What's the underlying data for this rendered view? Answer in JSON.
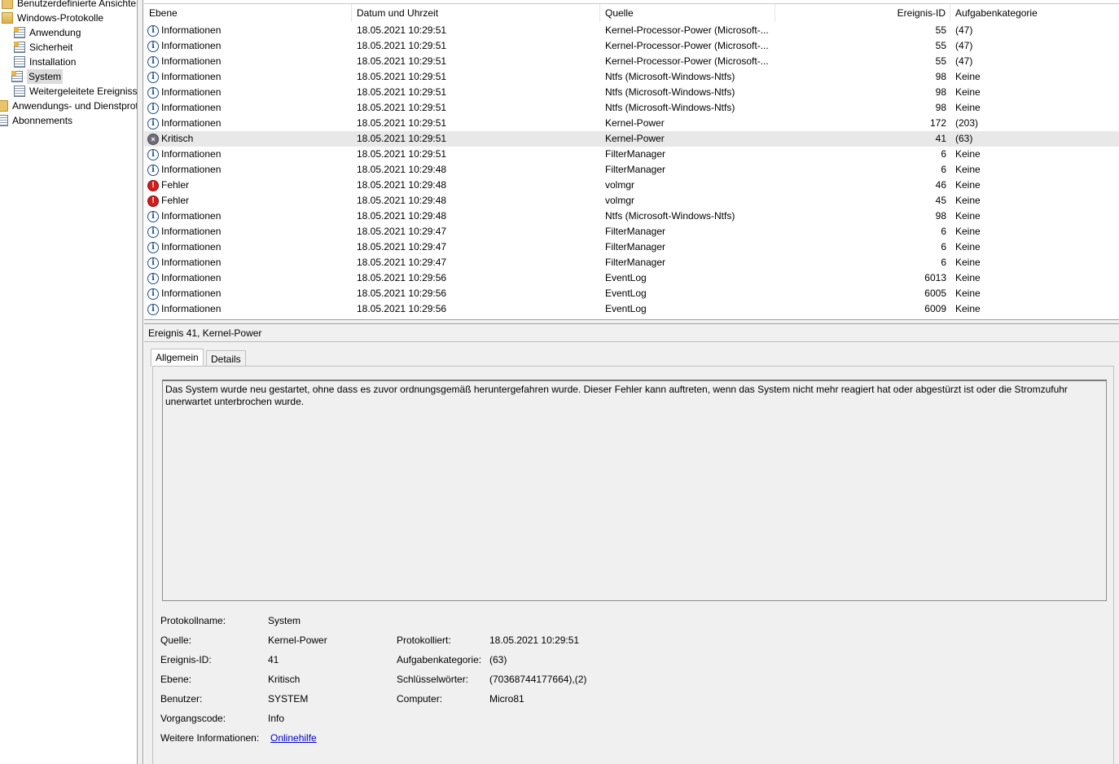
{
  "tree": {
    "items": [
      {
        "label": "Benutzerdefinierte Ansichten",
        "icon": "folder-icon"
      },
      {
        "label": "Windows-Protokolle",
        "icon": "folder-open-icon"
      },
      {
        "label": "Anwendung",
        "icon": "log-warning-icon"
      },
      {
        "label": "Sicherheit",
        "icon": "log-warning-icon"
      },
      {
        "label": "Installation",
        "icon": "log-icon"
      },
      {
        "label": "System",
        "icon": "log-warning-icon"
      },
      {
        "label": "Weitergeleitete Ereignisse",
        "icon": "log-icon"
      },
      {
        "label": "Anwendungs- und Dienstprotokolle",
        "icon": "folder-icon"
      },
      {
        "label": "Abonnements",
        "icon": "log-icon"
      }
    ]
  },
  "list": {
    "columns": [
      "Ebene",
      "Datum und Uhrzeit",
      "Quelle",
      "Ereignis-ID",
      "Aufgabenkategorie"
    ],
    "rows": [
      {
        "level": "Informationen",
        "type": "info",
        "date": "18.05.2021 10:29:51",
        "source": "Kernel-Processor-Power (Microsoft-...",
        "id": "55",
        "category": "(47)"
      },
      {
        "level": "Informationen",
        "type": "info",
        "date": "18.05.2021 10:29:51",
        "source": "Kernel-Processor-Power (Microsoft-...",
        "id": "55",
        "category": "(47)"
      },
      {
        "level": "Informationen",
        "type": "info",
        "date": "18.05.2021 10:29:51",
        "source": "Kernel-Processor-Power (Microsoft-...",
        "id": "55",
        "category": "(47)"
      },
      {
        "level": "Informationen",
        "type": "info",
        "date": "18.05.2021 10:29:51",
        "source": "Ntfs (Microsoft-Windows-Ntfs)",
        "id": "98",
        "category": "Keine"
      },
      {
        "level": "Informationen",
        "type": "info",
        "date": "18.05.2021 10:29:51",
        "source": "Ntfs (Microsoft-Windows-Ntfs)",
        "id": "98",
        "category": "Keine"
      },
      {
        "level": "Informationen",
        "type": "info",
        "date": "18.05.2021 10:29:51",
        "source": "Ntfs (Microsoft-Windows-Ntfs)",
        "id": "98",
        "category": "Keine"
      },
      {
        "level": "Informationen",
        "type": "info",
        "date": "18.05.2021 10:29:51",
        "source": "Kernel-Power",
        "id": "172",
        "category": "(203)"
      },
      {
        "level": "Kritisch",
        "type": "critical",
        "date": "18.05.2021 10:29:51",
        "source": "Kernel-Power",
        "id": "41",
        "category": "(63)"
      },
      {
        "level": "Informationen",
        "type": "info",
        "date": "18.05.2021 10:29:51",
        "source": "FilterManager",
        "id": "6",
        "category": "Keine"
      },
      {
        "level": "Informationen",
        "type": "info",
        "date": "18.05.2021 10:29:48",
        "source": "FilterManager",
        "id": "6",
        "category": "Keine"
      },
      {
        "level": "Fehler",
        "type": "error",
        "date": "18.05.2021 10:29:48",
        "source": "volmgr",
        "id": "46",
        "category": "Keine"
      },
      {
        "level": "Fehler",
        "type": "error",
        "date": "18.05.2021 10:29:48",
        "source": "volmgr",
        "id": "45",
        "category": "Keine"
      },
      {
        "level": "Informationen",
        "type": "info",
        "date": "18.05.2021 10:29:48",
        "source": "Ntfs (Microsoft-Windows-Ntfs)",
        "id": "98",
        "category": "Keine"
      },
      {
        "level": "Informationen",
        "type": "info",
        "date": "18.05.2021 10:29:47",
        "source": "FilterManager",
        "id": "6",
        "category": "Keine"
      },
      {
        "level": "Informationen",
        "type": "info",
        "date": "18.05.2021 10:29:47",
        "source": "FilterManager",
        "id": "6",
        "category": "Keine"
      },
      {
        "level": "Informationen",
        "type": "info",
        "date": "18.05.2021 10:29:47",
        "source": "FilterManager",
        "id": "6",
        "category": "Keine"
      },
      {
        "level": "Informationen",
        "type": "info",
        "date": "18.05.2021 10:29:56",
        "source": "EventLog",
        "id": "6013",
        "category": "Keine"
      },
      {
        "level": "Informationen",
        "type": "info",
        "date": "18.05.2021 10:29:56",
        "source": "EventLog",
        "id": "6005",
        "category": "Keine"
      },
      {
        "level": "Informationen",
        "type": "info",
        "date": "18.05.2021 10:29:56",
        "source": "EventLog",
        "id": "6009",
        "category": "Keine"
      }
    ]
  },
  "detail": {
    "title": "Ereignis 41, Kernel-Power",
    "tabs": {
      "general": "Allgemein",
      "details": "Details"
    },
    "description": "Das System wurde neu gestartet, ohne dass es zuvor ordnungsgemäß heruntergefahren wurde. Dieser Fehler kann auftreten, wenn das System nicht mehr reagiert hat oder abgestürzt ist oder die Stromzufuhr unerwartet unterbrochen wurde.",
    "props": {
      "log_name_label": "Protokollname:",
      "log_name": "System",
      "source_label": "Quelle:",
      "source": "Kernel-Power",
      "logged_label": "Protokolliert:",
      "logged": "18.05.2021 10:29:51",
      "event_id_label": "Ereignis-ID:",
      "event_id": "41",
      "task_cat_label": "Aufgabenkategorie:",
      "task_cat": "(63)",
      "level_label": "Ebene:",
      "level": "Kritisch",
      "keywords_label": "Schlüsselwörter:",
      "keywords": "(70368744177664),(2)",
      "user_label": "Benutzer:",
      "user": "SYSTEM",
      "computer_label": "Computer:",
      "computer": "Micro81",
      "opcode_label": "Vorgangscode:",
      "opcode": "Info",
      "more_info_label": "Weitere Informationen:",
      "more_info_link": "Onlinehilfe"
    }
  },
  "colors": {
    "selected_row": "#e8e8e8",
    "info_icon": "#1c4f8c",
    "error_icon": "#d11c1c",
    "critical_icon": "#6e6e78",
    "link": "#0000cc"
  }
}
